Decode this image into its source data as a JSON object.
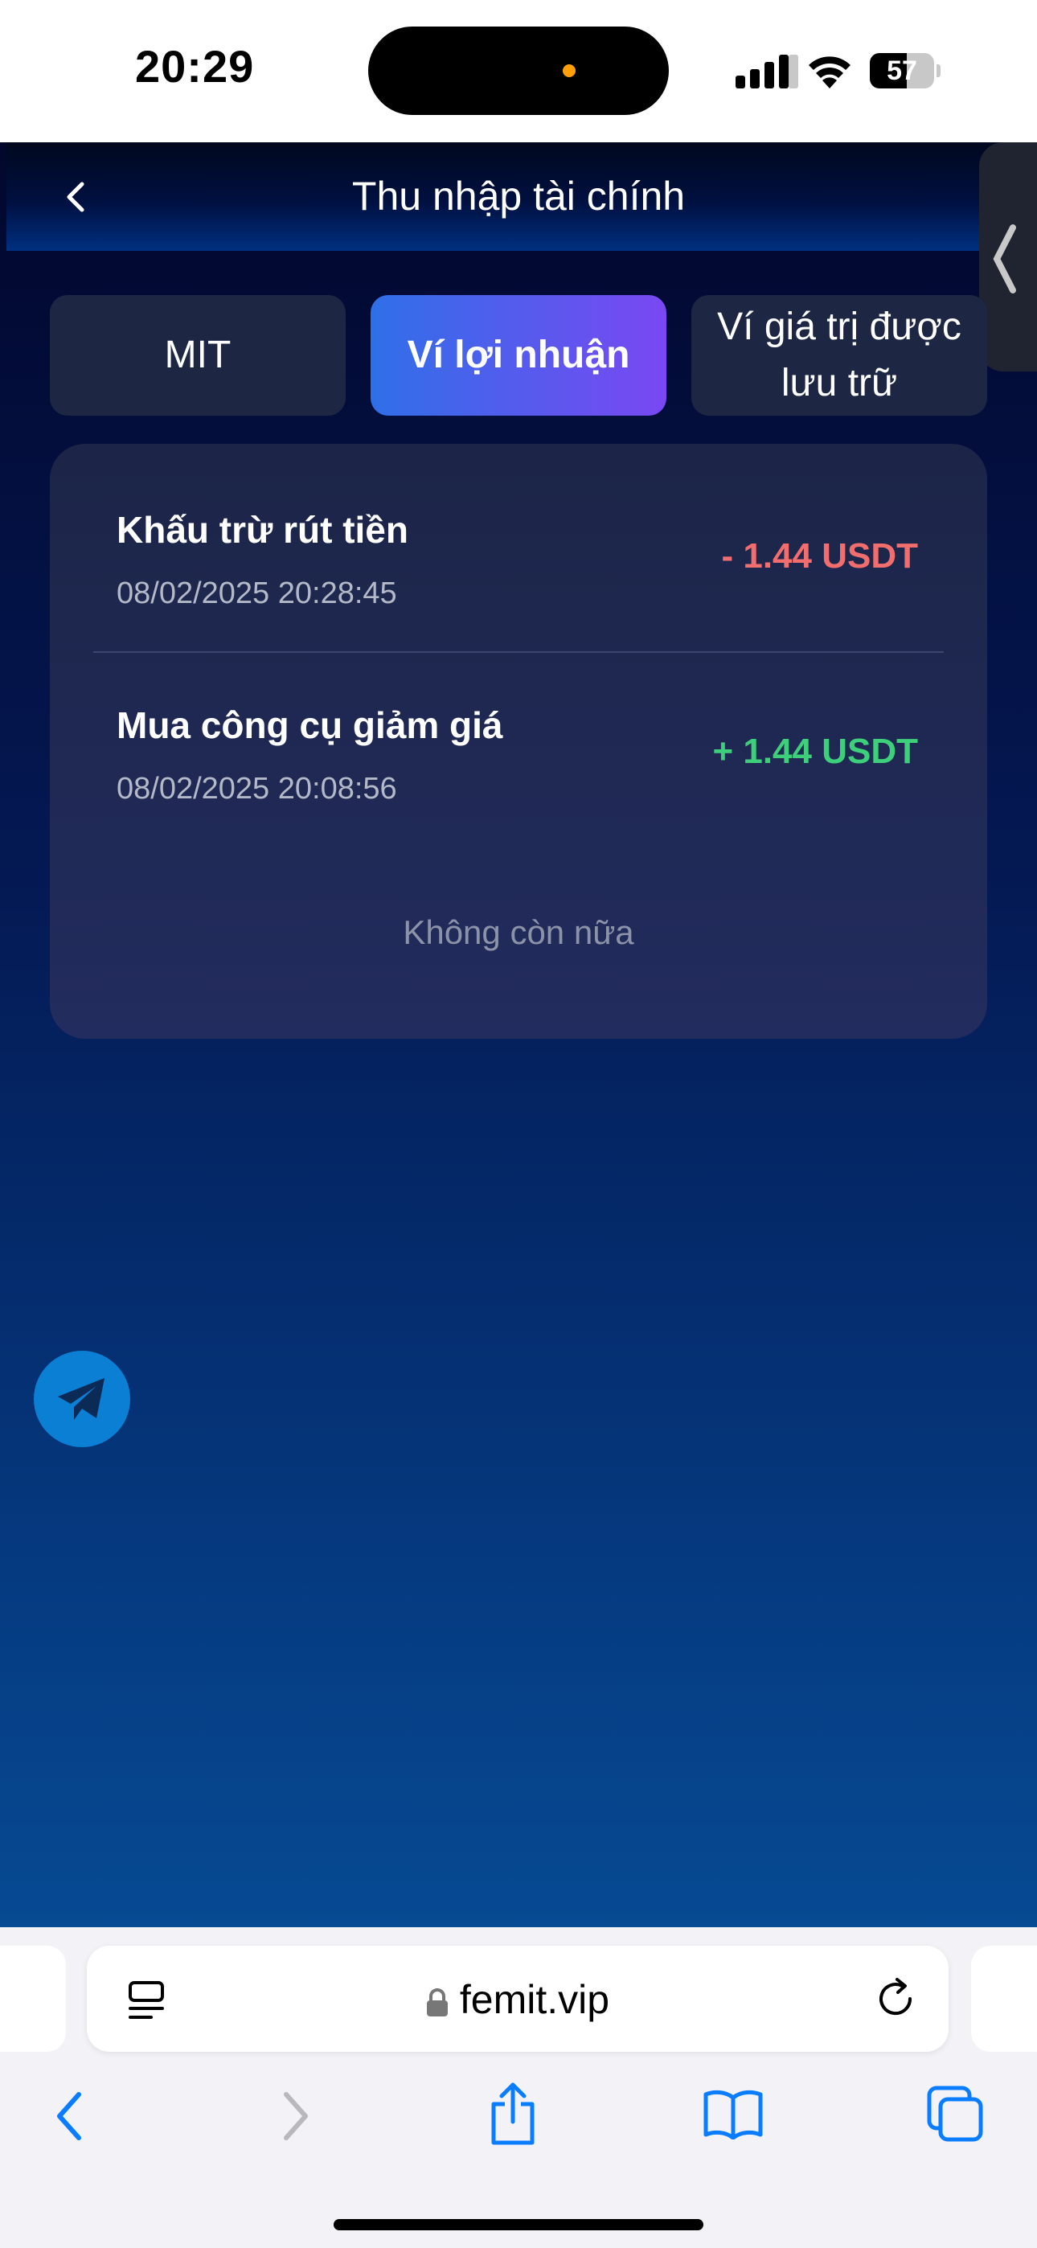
{
  "status_bar": {
    "time": "20:29",
    "battery": "57",
    "battery_level": 0.57
  },
  "header": {
    "title": "Thu nhập tài chính",
    "back_icon": "chevron-left-icon"
  },
  "tabs": [
    {
      "label": "MIT",
      "active": false
    },
    {
      "label": "Ví lợi nhuận",
      "active": true
    },
    {
      "label": "Ví giá trị được lưu trữ",
      "active": false
    }
  ],
  "transactions": [
    {
      "name": "Khấu trừ rút tiền",
      "date": "08/02/2025 20:28:45",
      "amount": "- 1.44 USDT",
      "color": "#f26d6d"
    },
    {
      "name": "Mua công cụ giảm giá",
      "date": "08/02/2025 20:08:56",
      "amount": "+ 1.44 USDT",
      "color": "#3ecf7a"
    }
  ],
  "list_end_text": "Không còn nữa",
  "browser": {
    "url": "femit.vip"
  },
  "colors": {
    "accent_start": "#2f6fe8",
    "accent_end": "#7a48f2",
    "telegram": "#0a7fd4"
  }
}
